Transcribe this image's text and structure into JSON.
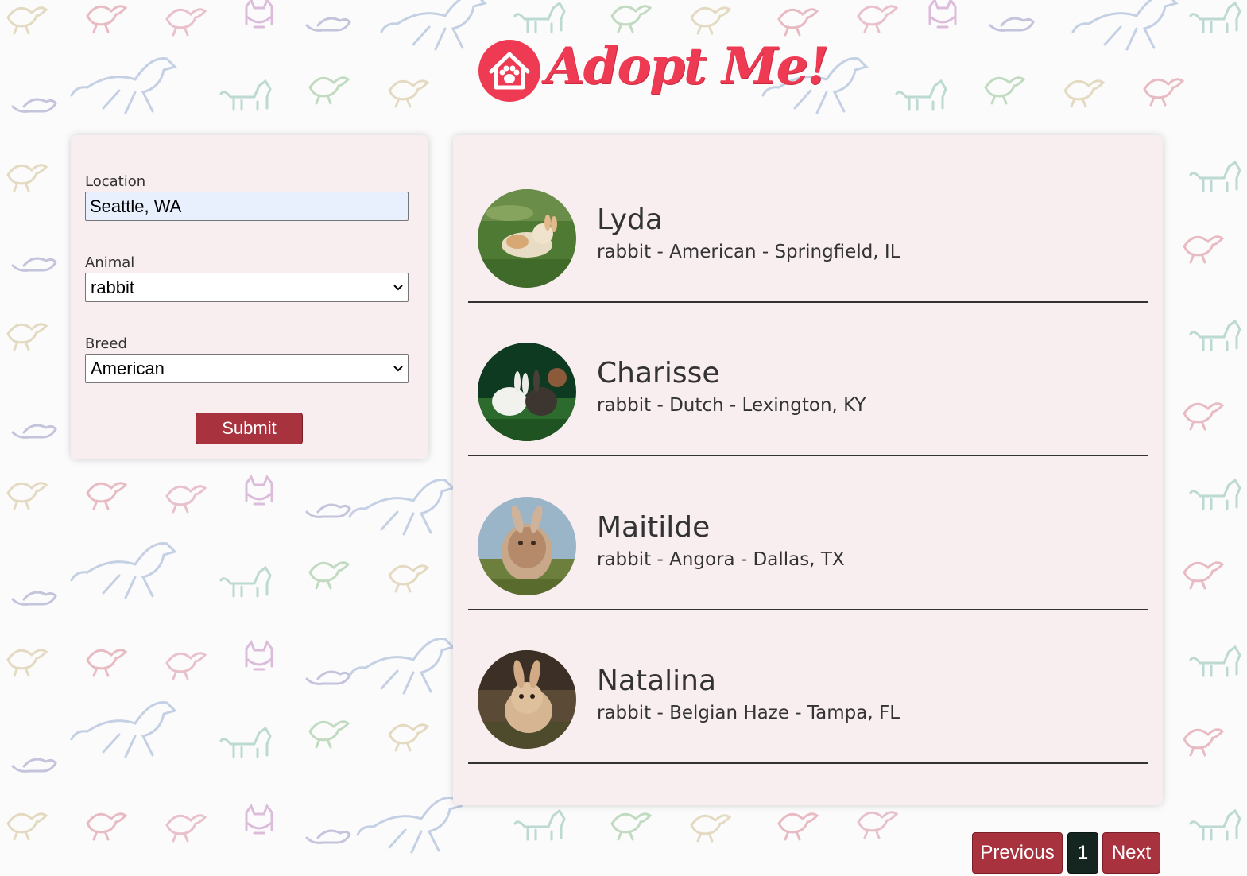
{
  "header": {
    "logo_text": "Adopt Me!"
  },
  "search": {
    "location_label": "Location",
    "location_value": "Seattle, WA",
    "animal_label": "Animal",
    "animal_value": "rabbit",
    "breed_label": "Breed",
    "breed_value": "American",
    "submit_label": "Submit"
  },
  "results": [
    {
      "name": "Lyda",
      "info": "rabbit - American - Springfield, IL"
    },
    {
      "name": "Charisse",
      "info": "rabbit - Dutch - Lexington, KY"
    },
    {
      "name": "Maitilde",
      "info": "rabbit - Angora - Dallas, TX"
    },
    {
      "name": "Natalina",
      "info": "rabbit - Belgian Haze - Tampa, FL"
    }
  ],
  "pagination": {
    "previous_label": "Previous",
    "current_page": "1",
    "next_label": "Next"
  },
  "colors": {
    "brand": "#ee3b53",
    "button": "#a8323e",
    "page_active": "#152520",
    "panel": "#f8eef0"
  },
  "icons": {
    "logo": "house-paw-icon",
    "select": "chevron-down-icon"
  }
}
